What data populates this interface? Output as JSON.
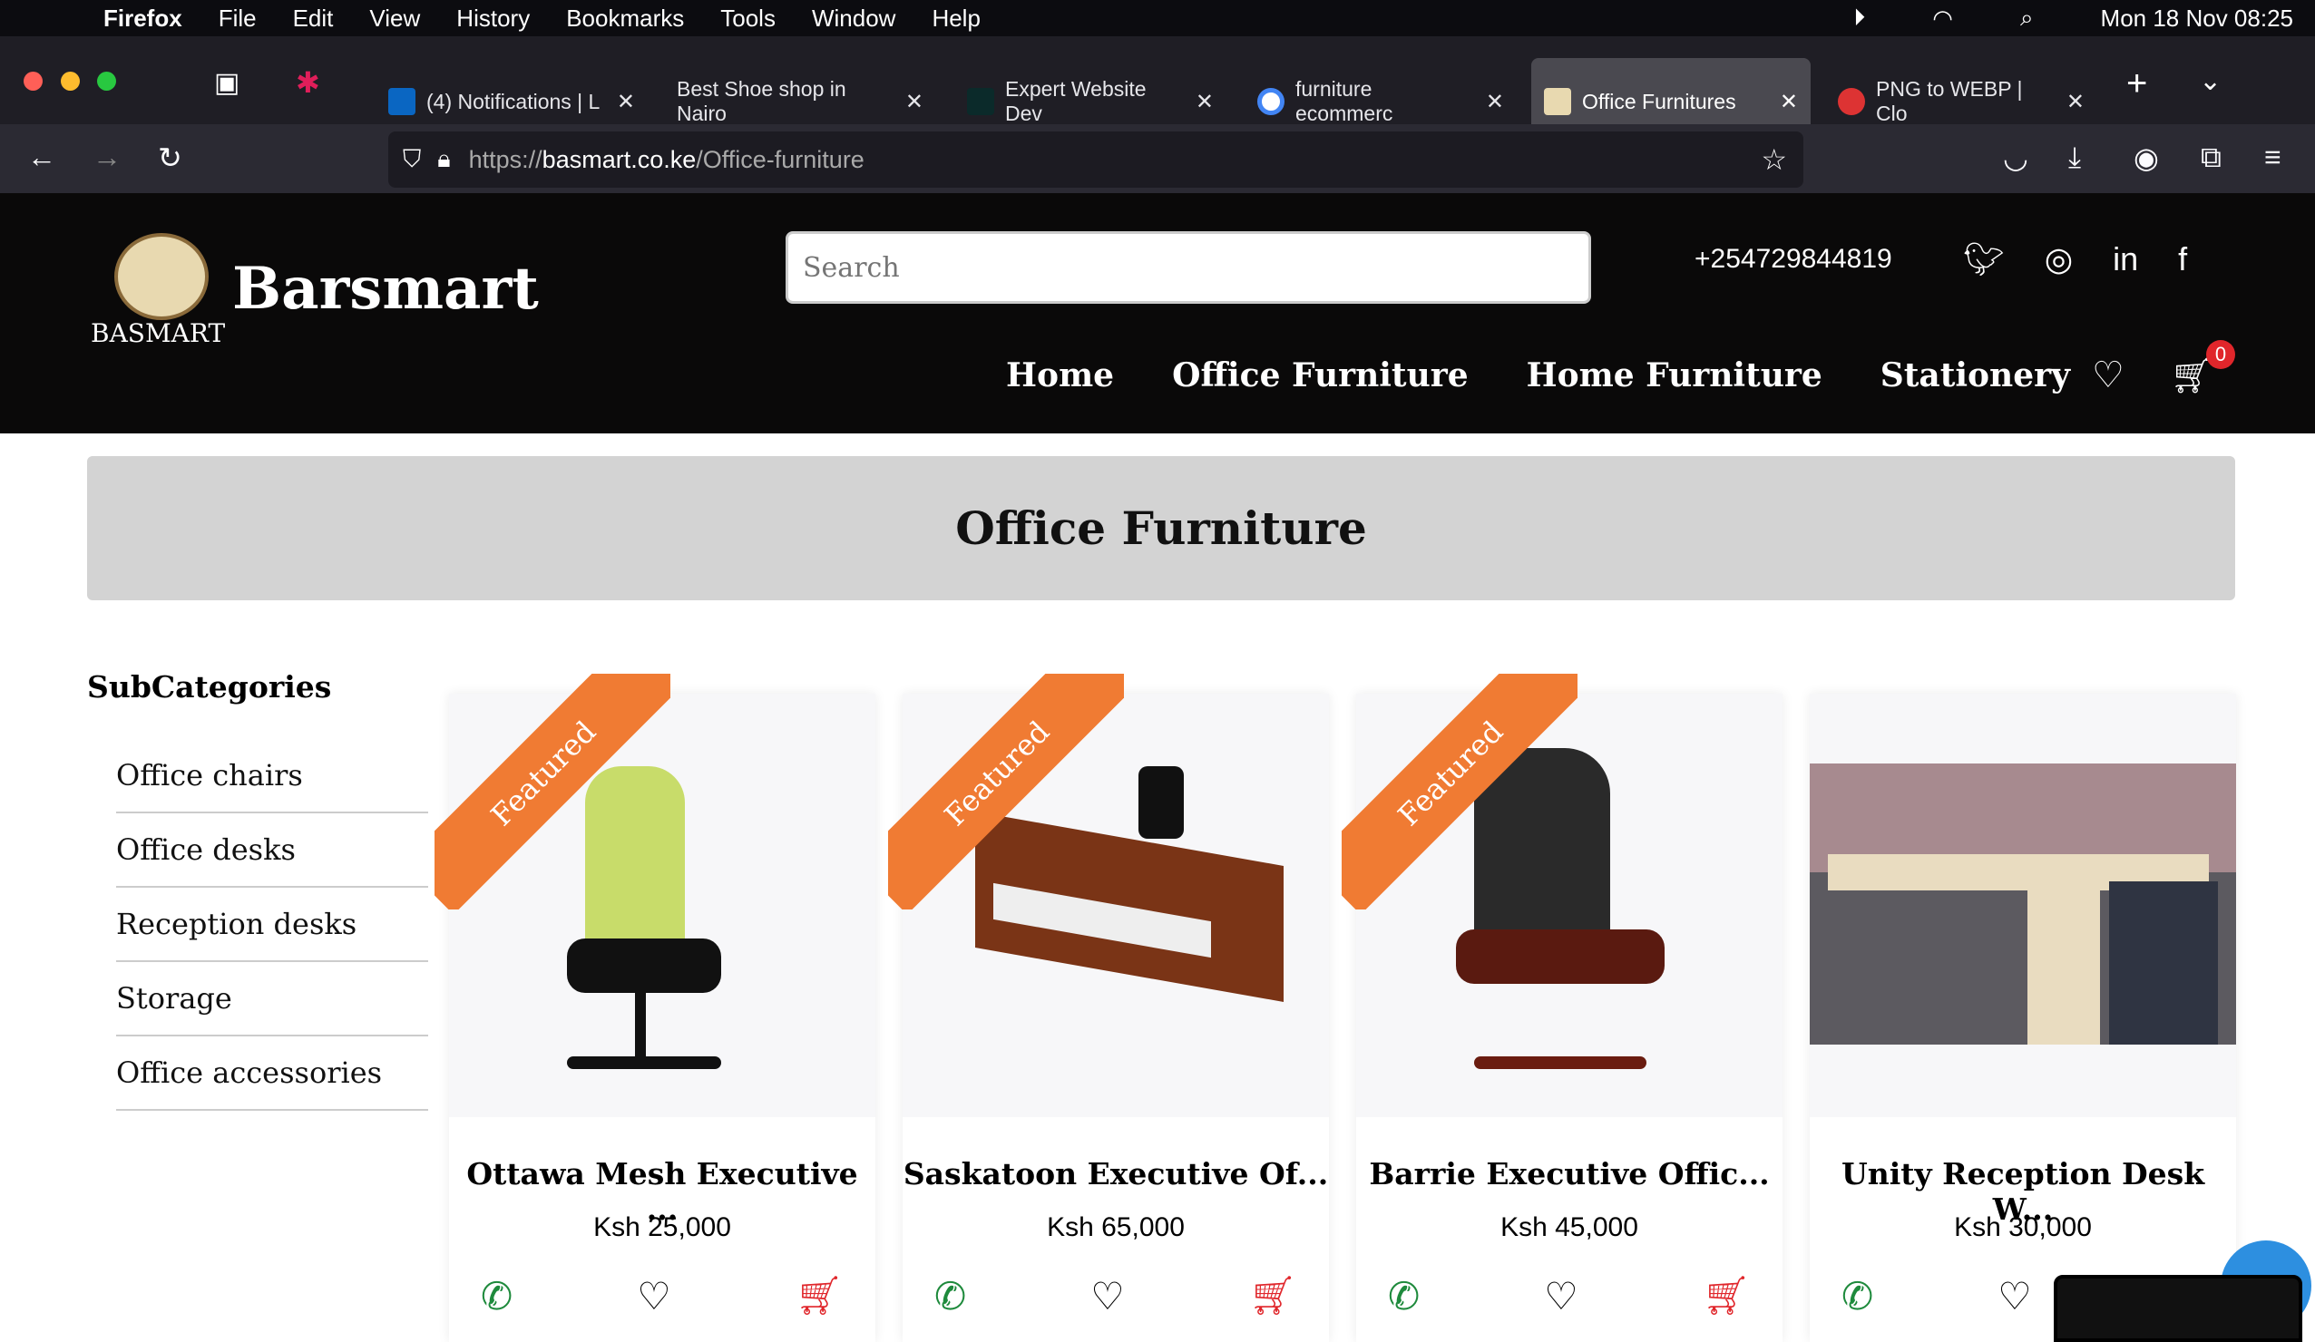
{
  "menubar": {
    "app": "Firefox",
    "items": [
      "File",
      "Edit",
      "View",
      "History",
      "Bookmarks",
      "Tools",
      "Window",
      "Help"
    ],
    "clock": "Mon 18 Nov  08:25"
  },
  "tabs": [
    {
      "label": "(4) Notifications | L",
      "color": "#0a66c2"
    },
    {
      "label": "Best Shoe shop in Nairo",
      "color": "transparent"
    },
    {
      "label": "Expert Website Dev",
      "color": "#0b2a2a"
    },
    {
      "label": "furniture ecommerc",
      "color": "#ffffff"
    },
    {
      "label": "Office Furnitures",
      "color": "#e8d9b0",
      "active": true
    },
    {
      "label": "PNG to WEBP | Clo",
      "color": "#d33"
    }
  ],
  "url": {
    "prefix": "https://",
    "host": "basmart.co.ke",
    "path": "/Office-furniture"
  },
  "site": {
    "brand": "Barsmart",
    "logo_text": "BASMART",
    "search_placeholder": "Search",
    "phone": "+254729844819",
    "nav": [
      "Home",
      "Office Furniture",
      "Home Furniture",
      "Stationery"
    ],
    "cart_count": "0"
  },
  "banner": {
    "title": "Office Furniture"
  },
  "sidebar": {
    "title": "SubCategories",
    "items": [
      "Office chairs",
      "Office desks",
      "Reception desks",
      "Storage",
      "Office accessories"
    ]
  },
  "ribbon": "Featured",
  "products": [
    {
      "title": "Ottawa Mesh Executive ...",
      "price": "Ksh 25,000",
      "featured": true
    },
    {
      "title": "Saskatoon Executive Of...",
      "price": "Ksh 65,000",
      "featured": true
    },
    {
      "title": "Barrie Executive Offic...",
      "price": "Ksh 45,000",
      "featured": true
    },
    {
      "title": "Unity Reception Desk W...",
      "price": "Ksh 30,000",
      "featured": false
    }
  ],
  "colors": {
    "accent": "#f07b33",
    "cart": "#e0262b",
    "whatsapp": "#1e8a3c",
    "header": "#0a0909"
  }
}
